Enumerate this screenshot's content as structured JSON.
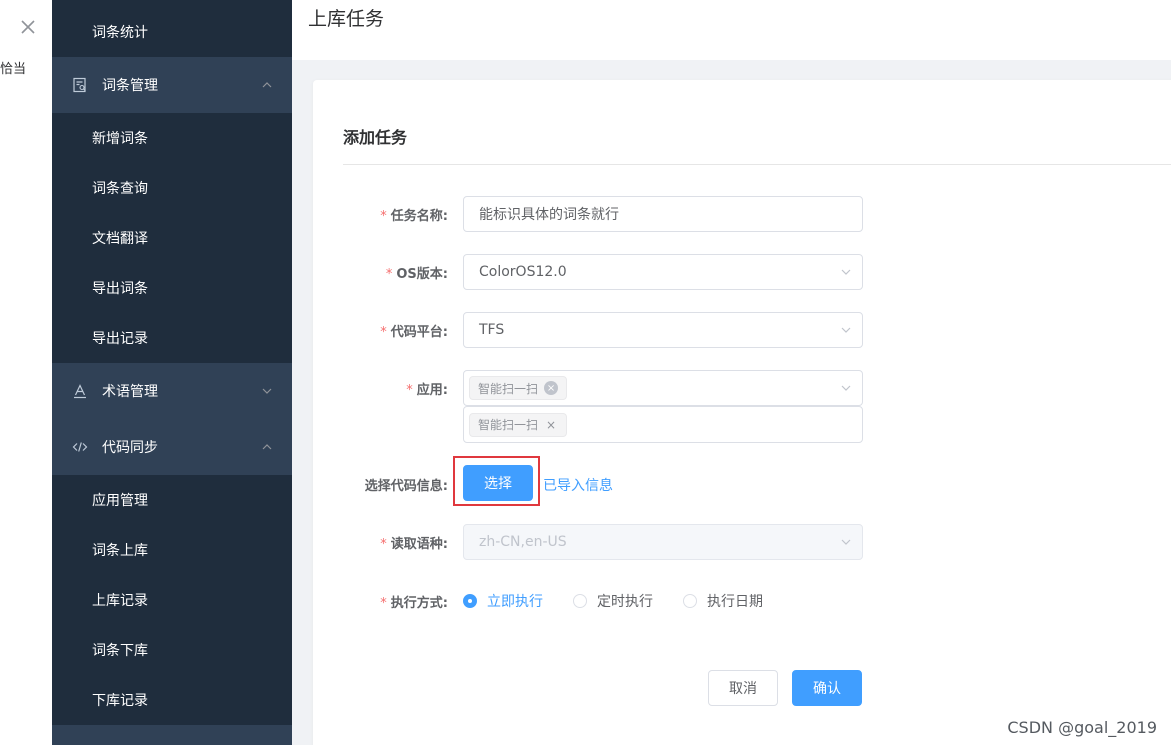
{
  "left_strip": {
    "text": "恰当"
  },
  "sidebar": {
    "items": [
      {
        "label": "词条统计",
        "type": "sub"
      },
      {
        "label": "词条管理",
        "type": "parent",
        "icon": "document-icon",
        "expanded": true
      },
      {
        "label": "新增词条",
        "type": "sub"
      },
      {
        "label": "词条查询",
        "type": "sub"
      },
      {
        "label": "文档翻译",
        "type": "sub"
      },
      {
        "label": "导出词条",
        "type": "sub"
      },
      {
        "label": "导出记录",
        "type": "sub"
      },
      {
        "label": "术语管理",
        "type": "parent",
        "icon": "text-a-icon",
        "expanded": false
      },
      {
        "label": "代码同步",
        "type": "parent",
        "icon": "code-icon",
        "expanded": true
      },
      {
        "label": "应用管理",
        "type": "sub"
      },
      {
        "label": "词条上库",
        "type": "sub"
      },
      {
        "label": "上库记录",
        "type": "sub"
      },
      {
        "label": "词条下库",
        "type": "sub"
      },
      {
        "label": "下库记录",
        "type": "sub"
      }
    ]
  },
  "header": {
    "title": "上库任务"
  },
  "form": {
    "title": "添加任务",
    "task_name": {
      "label": "任务名称:",
      "value": "能标识具体的词条就行"
    },
    "os_version": {
      "label": "OS版本:",
      "value": "ColorOS12.0"
    },
    "code_platform": {
      "label": "代码平台:",
      "value": "TFS"
    },
    "application": {
      "label": "应用:",
      "selected_tag": "智能扫一扫",
      "dropdown_tag": "智能扫一扫"
    },
    "code_info": {
      "label": "选择代码信息:",
      "button": "选择",
      "link": "已导入信息"
    },
    "read_language": {
      "label": "读取语种:",
      "value": "zh-CN,en-US"
    },
    "exec_mode": {
      "label": "执行方式:",
      "options": [
        "立即执行",
        "定时执行",
        "执行日期"
      ],
      "selected": "立即执行"
    },
    "cancel": "取消",
    "confirm": "确认"
  },
  "watermark": "CSDN @goal_2019",
  "colors": {
    "primary": "#409eff",
    "sidebar_bg": "#1f2d3d",
    "sidebar_parent_bg": "#304156",
    "required": "#f56c6c",
    "highlight_box": "#e0383e"
  }
}
